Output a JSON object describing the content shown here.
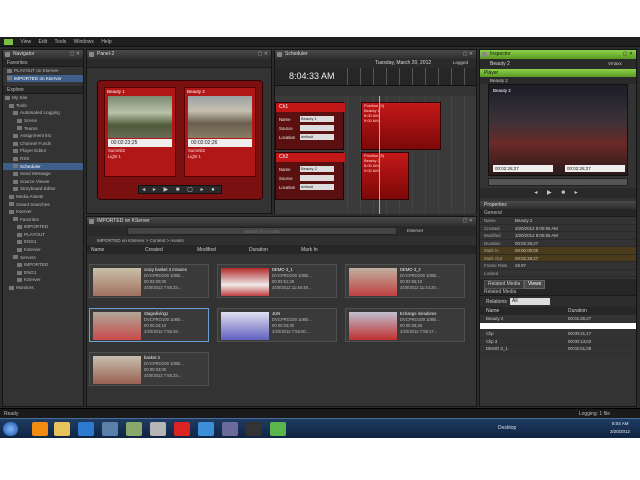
{
  "menubar": {
    "items": [
      "View",
      "Edit",
      "Tools",
      "Windows",
      "Help"
    ]
  },
  "navigator": {
    "title": "Navigator",
    "favorites_label": "Favorites",
    "favorites": [
      "PLAYOUT on Kserver",
      "IMPORTED on Kserver"
    ],
    "explore_label": "Explore",
    "tree": [
      "My Site",
      "Tools",
      "Automated Logging",
      "Scene",
      "Teams",
      "Assignment list",
      "Channel Funds",
      "Player Editor",
      "RSS",
      "Scheduler",
      "Send Message",
      "Source Viewer",
      "Storyboard Editor",
      "Media Assets",
      "Saved Searches",
      "Kserver",
      "Favorites",
      "IMPORTED",
      "PLAYOUT",
      "ENG1",
      "KServer",
      "Servers",
      "IMPORTED",
      "ENG1",
      "KServer",
      "Monitors"
    ]
  },
  "panel2": {
    "title": "Panel-2",
    "monitor1": {
      "name": "Beauty 1",
      "tc": "00:02:23;25",
      "sub": "Summit2",
      "line": "Light 1"
    },
    "monitor2": {
      "name": "Beauty 2",
      "tc": "00:02:02;26",
      "sub": "Summit2",
      "line": "Light 1"
    }
  },
  "scheduler": {
    "title": "Scheduler",
    "date": "Tuesday, March 20, 2012",
    "mode": "Logged",
    "clock": "8:04:33 AM",
    "rows": [
      {
        "id": "Ch1",
        "name_label": "Name",
        "name_val": "Beauty 1",
        "source_label": "Source",
        "location_label": "Location",
        "location_val": "default"
      },
      {
        "id": "Ch2",
        "name_label": "Name",
        "name_val": "Beauty 2",
        "source_label": "Source",
        "location_label": "Location",
        "location_val": "default"
      }
    ],
    "clips": [
      {
        "title": "Position (4)",
        "l1": "Beauty 1",
        "l2": "8:00 AM",
        "l3": "9:00 AM"
      },
      {
        "title": "Position (5)",
        "l1": "Beauty 2",
        "l2": "8:00 AM",
        "l3": "9:00 AM"
      }
    ]
  },
  "assets": {
    "title": "IMPORTED on KServer",
    "search_placeholder": "Search for Assets",
    "location": "KServer",
    "breadcrumb": "IMPORTED on KServer > Content > Assets",
    "columns": [
      "Name",
      "Created",
      "Modified",
      "Duration",
      "Mark In"
    ],
    "cards": [
      {
        "title": "crazy basket 3 minutes",
        "format": "DVCPRO100 1080i...",
        "duration": "00:03:00;00",
        "modified": "3/20/2012 7:55:33..."
      },
      {
        "title": "DEMO 3_1",
        "format": "DVCPRO100 1080i...",
        "duration": "00:02:51;28",
        "modified": "3/20/2012 11:48:48..."
      },
      {
        "title": "DEMO 3_2",
        "format": "DVCPRO100 1080i...",
        "duration": "00:02:56;10",
        "modified": "3/20/2012 11:44:20..."
      },
      {
        "title": "Stagediving1",
        "format": "DVCPRO100 1080i...",
        "duration": "00:00:24;10",
        "modified": "3/20/2012 7:55:48..."
      },
      {
        "title": "JUN",
        "format": "DVCPRO100 1080i...",
        "duration": "00:00:03;00",
        "modified": "3/20/2012 7:55:00..."
      },
      {
        "title": "Echange miradores",
        "format": "DVCPRO100 1080i...",
        "duration": "00:00:28;26",
        "modified": "3/20/2012 7:55:17..."
      },
      {
        "title": "basket 3",
        "format": "DVCPRO100 1080i...",
        "duration": "00:00:03;00",
        "modified": "3/20/2012 7:55:33..."
      }
    ]
  },
  "inspector": {
    "title": "Inspector",
    "asset": "Beauty 2",
    "mode": "Vmaxx",
    "player_label": "Player",
    "player_name": "Beauty 2",
    "tc_left": "00:02:26;27",
    "tc_right": "00:02:26;27",
    "properties_label": "Properties",
    "general_label": "General",
    "props": [
      {
        "k": "Name",
        "v": "Beauty 2"
      },
      {
        "k": "Created",
        "v": "3/20/2012 8:00:55 AM"
      },
      {
        "k": "Modified",
        "v": "3/20/2012 8:00:55 AM"
      },
      {
        "k": "Duration",
        "v": "00:02:26;27"
      },
      {
        "k": "Mark In",
        "v": "00:00:00;00"
      },
      {
        "k": "Mark Out",
        "v": "00:02:26;27"
      },
      {
        "k": "Frame Rate",
        "v": "29.97"
      },
      {
        "k": "Locked",
        "v": ""
      }
    ],
    "tabs": [
      "Related Media",
      "Views"
    ],
    "subtab": "Related Media",
    "relations_label": "Relations",
    "relations_val": "All",
    "cols": [
      "Name",
      "Duration"
    ],
    "rows": [
      {
        "n": "Beauty 2",
        "d": "00:02:26;27"
      },
      {
        "n": "",
        "d": ""
      },
      {
        "n": "Clip",
        "d": "00:00:21;17"
      },
      {
        "n": "Clip 3",
        "d": "00:00:13;02"
      },
      {
        "n": "DEMO 3_1",
        "d": "00:02:51;28"
      }
    ]
  },
  "status": {
    "left": "Ready",
    "right": "Logging: 1 file"
  },
  "taskbar": {
    "desktop": "Desktop",
    "time": "8:04 AM",
    "date": "3/20/2012"
  }
}
